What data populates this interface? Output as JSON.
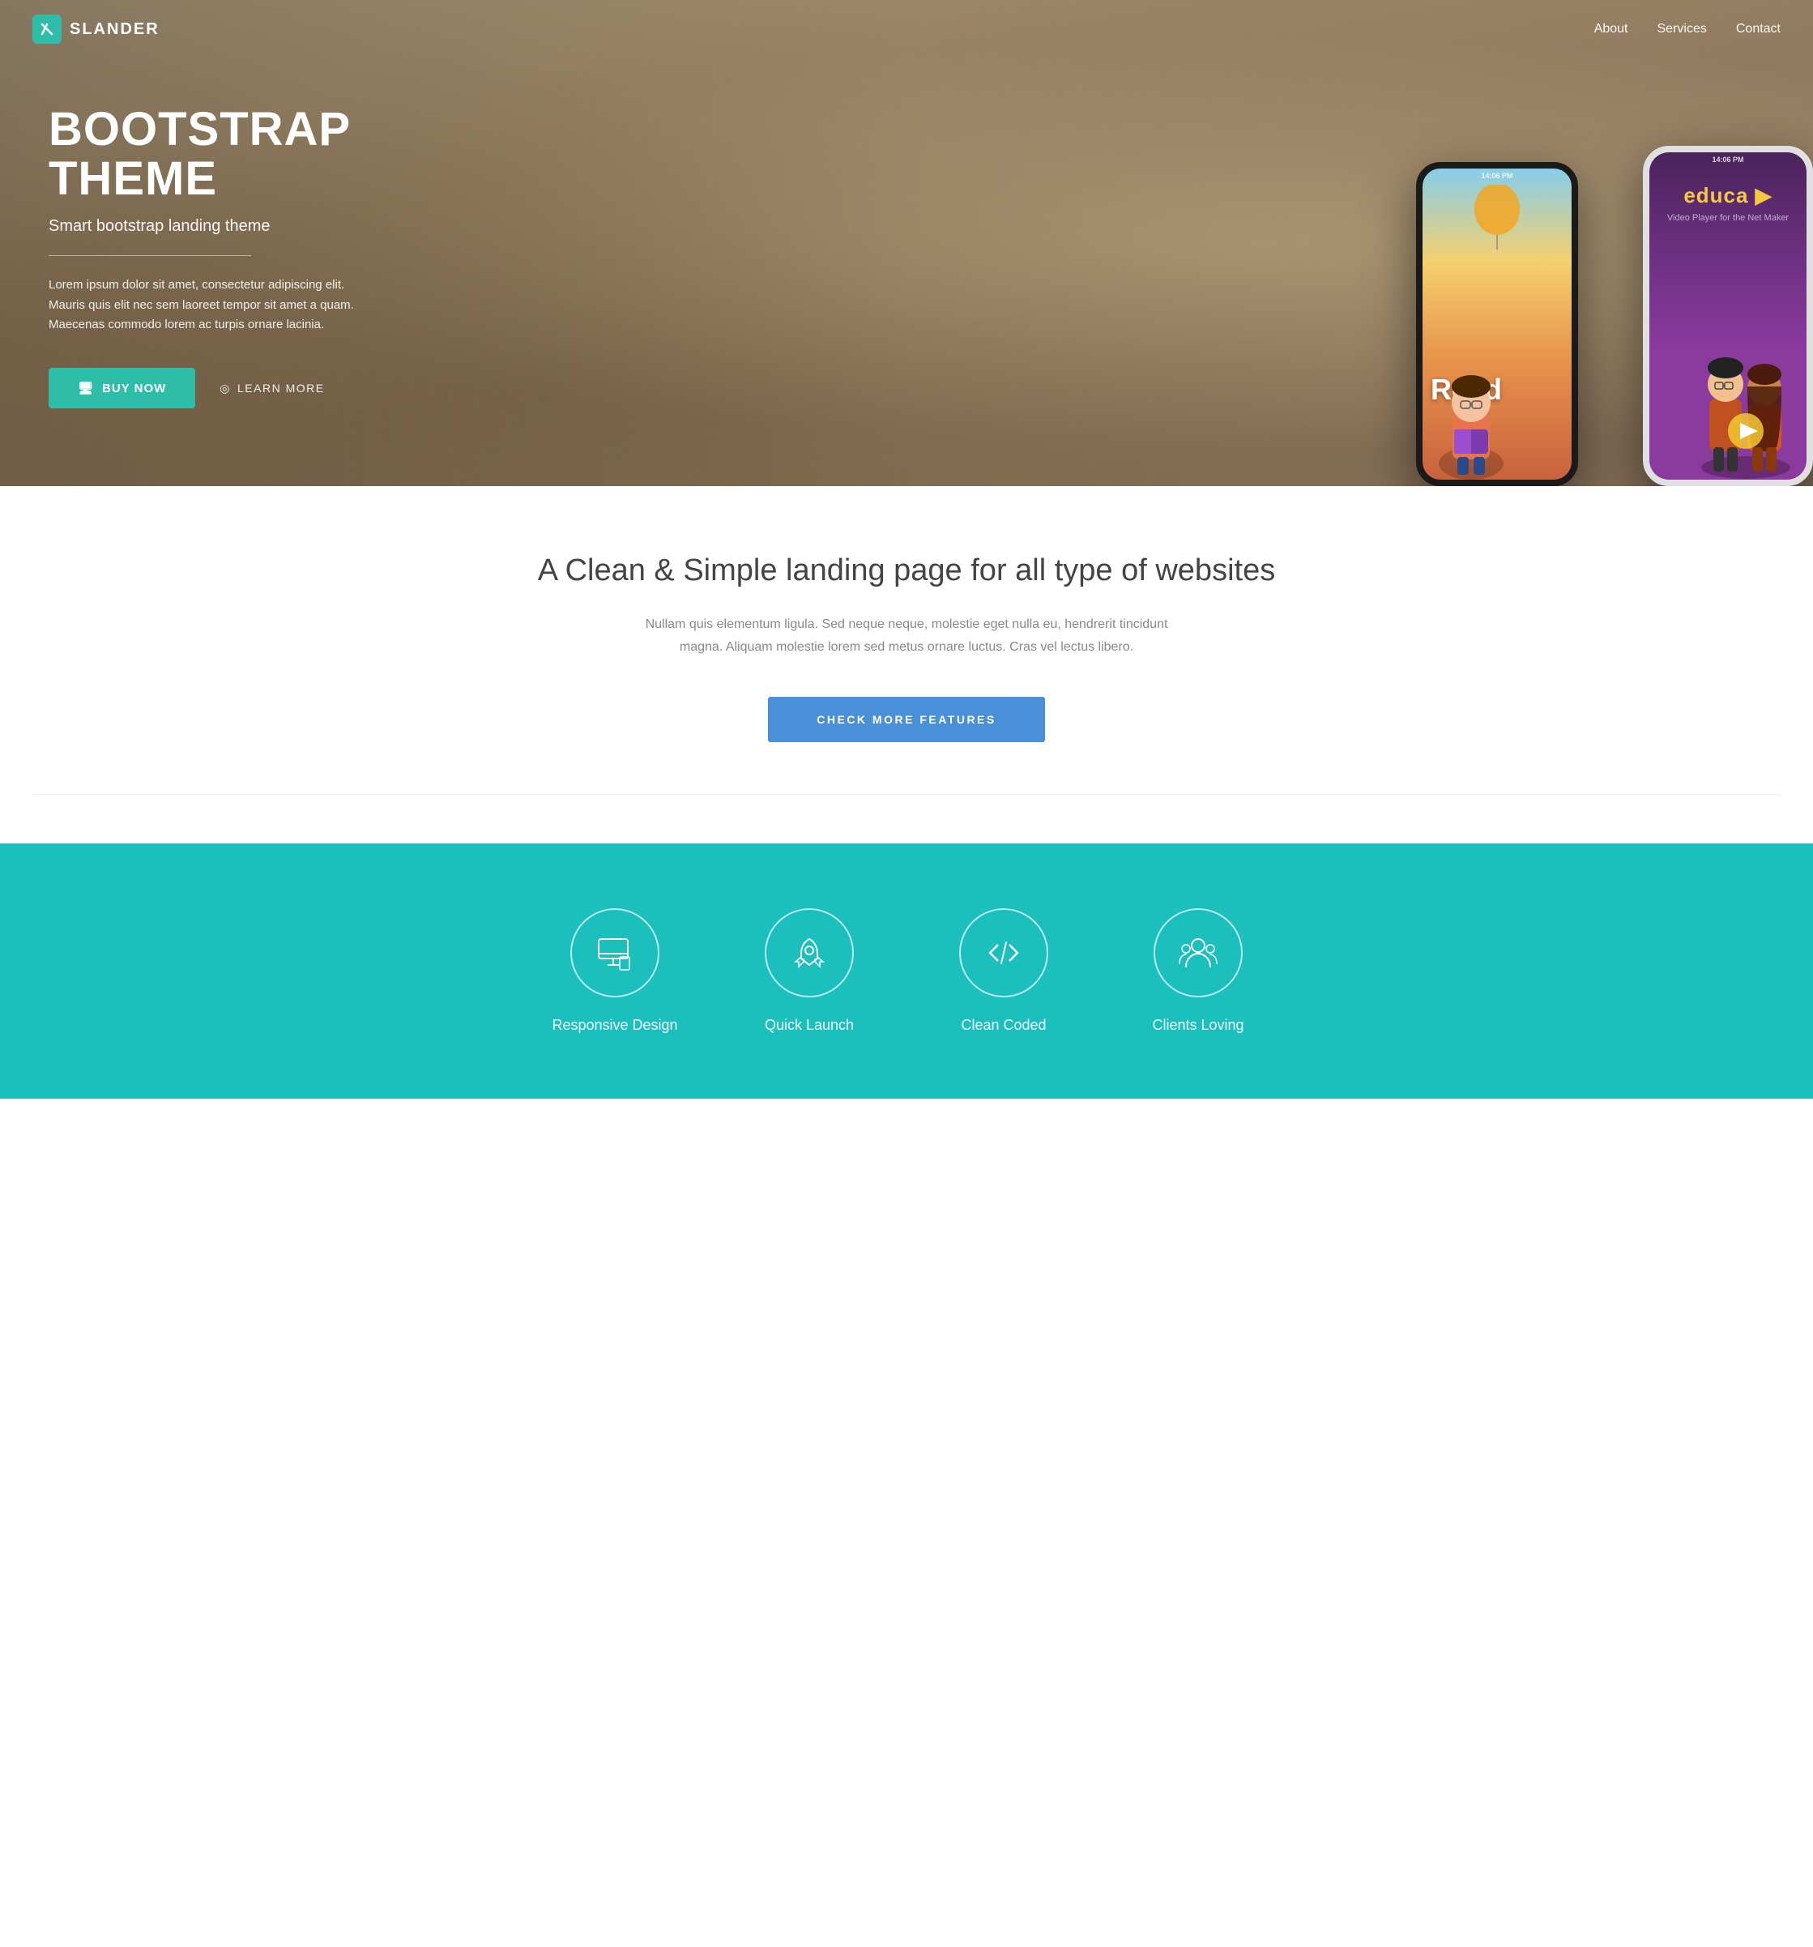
{
  "navbar": {
    "logo_icon": "/",
    "logo_text": "SLANDER",
    "links": [
      {
        "label": "About",
        "href": "#"
      },
      {
        "label": "Services",
        "href": "#"
      },
      {
        "label": "Contact",
        "href": "#"
      }
    ]
  },
  "hero": {
    "title": "BOOTSTRAP\nTHEME",
    "subtitle": "Smart bootstrap landing theme",
    "description": "Lorem ipsum dolor sit amet, consectetur adipiscing elit. Mauris quis elit nec sem laoreet tempor sit amet a quam. Maecenas commodo lorem ac turpis ornare lacinia.",
    "buy_label": "BUY NOW",
    "learn_label": "LEARN MORE",
    "phone_black_time": "14:06 PM",
    "phone_white_time": "14:06 PM",
    "phone_black_app": "Read",
    "phone_white_app": "educa"
  },
  "middle": {
    "title": "A Clean & Simple landing page for all type of websites",
    "description": "Nullam quis elementum ligula. Sed neque neque, molestie eget nulla eu, hendrerit tincidunt magna.\nAliquam molestie lorem sed metus ornare luctus. Cras vel lectus libero.",
    "button_label": "CHECK MORE FEATURES"
  },
  "features": {
    "section_bg": "#1bbfbc",
    "items": [
      {
        "label": "Responsive Design",
        "icon": "monitor"
      },
      {
        "label": "Quick Launch",
        "icon": "rocket"
      },
      {
        "label": "Clean Coded",
        "icon": "code"
      },
      {
        "label": "Clients Loving",
        "icon": "users"
      }
    ]
  }
}
